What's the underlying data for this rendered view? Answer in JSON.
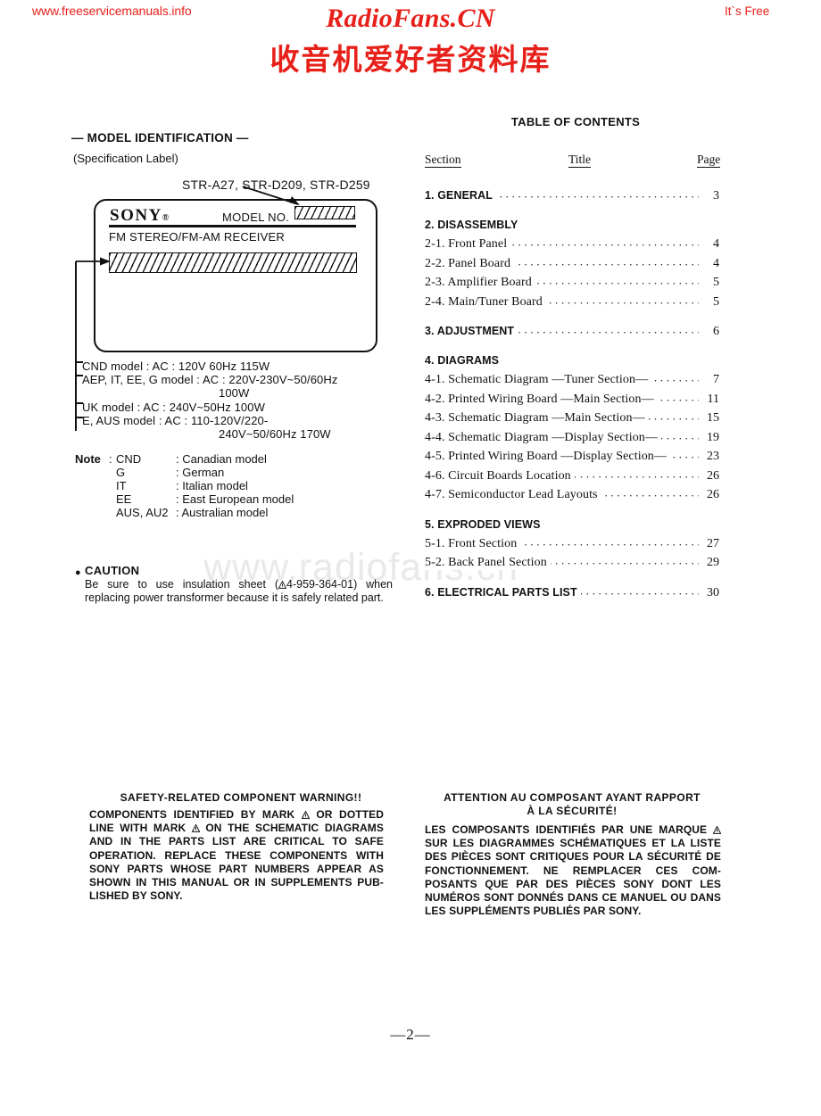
{
  "banner": {
    "left_url": "www.freeservicemanuals.info",
    "site_title": "RadioFans.CN",
    "site_subtitle": "收音机爱好者资料库",
    "right_note": "It`s Free",
    "brand_color": "#e8201a"
  },
  "watermark": "www.radiofans.cn",
  "model_identification": {
    "heading": "— MODEL IDENTIFICATION —",
    "subheading": "(Specification Label)",
    "model_numbers": "STR-A27, STR-D209, STR-D259",
    "label": {
      "brand": "SONY",
      "brand_mark": "®",
      "model_no_label": "MODEL NO.",
      "receiver_line": "FM  STEREO/FM-AM  RECEIVER"
    },
    "voltages": [
      "CND  model : AC : 120V  60Hz  115W",
      "AEP, IT, EE, G  model : AC : 220V-230V~50/60Hz",
      "100W",
      "UK  model : AC : 240V~50Hz  100W",
      "E, AUS  model : AC : 110-120V/220-",
      "240V~50/60Hz  170W"
    ],
    "note_label": "Note",
    "note_colon": ":",
    "notes": [
      {
        "key": "CND",
        "value": ": Canadian  model"
      },
      {
        "key": "G",
        "value": ": German"
      },
      {
        "key": "IT",
        "value": ": Italian  model"
      },
      {
        "key": "EE",
        "value": ": East  European  model"
      },
      {
        "key": "AUS, AU2",
        "value": ": Australian  model"
      }
    ]
  },
  "caution": {
    "bullet": "●",
    "title": "CAUTION",
    "body_part1": "Be sure to use insulation sheet (",
    "body_part2": "4-959-364-01) when replacing power transformer because it is safely related part."
  },
  "toc": {
    "title": "TABLE OF CONTENTS",
    "headers": {
      "section": "Section",
      "title": "Title",
      "page": "Page"
    },
    "entries": [
      {
        "type": "major",
        "label": "1. GENERAL",
        "page": "3",
        "dots": true
      },
      {
        "type": "major",
        "label": "2. DISASSEMBLY",
        "page": "",
        "dots": false
      },
      {
        "type": "sub",
        "label": "2-1. Front  Panel",
        "page": "4",
        "dots": true
      },
      {
        "type": "sub",
        "label": "2-2. Panel  Board",
        "page": "4",
        "dots": true
      },
      {
        "type": "sub",
        "label": "2-3. Amplifier  Board",
        "page": "5",
        "dots": true
      },
      {
        "type": "sub",
        "label": "2-4. Main/Tuner  Board",
        "page": "5",
        "dots": true
      },
      {
        "type": "major",
        "label": "3. ADJUSTMENT",
        "page": "6",
        "dots": true
      },
      {
        "type": "major",
        "label": "4. DIAGRAMS",
        "page": "",
        "dots": false
      },
      {
        "type": "sub",
        "label": "4-1. Schematic  Diagram —Tuner  Section—",
        "page": "7",
        "dots": true
      },
      {
        "type": "sub",
        "label": "4-2. Printed  Wiring  Board —Main  Section—",
        "page": "11",
        "dots": true
      },
      {
        "type": "sub",
        "label": "4-3. Schematic  Diagram —Main  Section—",
        "page": "15",
        "dots": true
      },
      {
        "type": "sub",
        "label": "4-4. Schematic  Diagram —Display  Section—",
        "page": "19",
        "dots": true
      },
      {
        "type": "sub",
        "label": "4-5. Printed  Wiring  Board —Display  Section—",
        "page": "23",
        "dots": true
      },
      {
        "type": "sub",
        "label": "4-6. Circuit  Boards  Location",
        "page": "26",
        "dots": true
      },
      {
        "type": "sub",
        "label": "4-7. Semiconductor  Lead  Layouts",
        "page": "26",
        "dots": true
      },
      {
        "type": "major",
        "label": "5. EXPRODED VIEWS",
        "page": "",
        "dots": false
      },
      {
        "type": "sub",
        "label": "5-1. Front  Section",
        "page": "27",
        "dots": true
      },
      {
        "type": "sub",
        "label": "5-2. Back  Panel  Section",
        "page": "29",
        "dots": true
      },
      {
        "type": "major",
        "label": "6. ELECTRICAL PARTS LIST",
        "page": "30",
        "dots": true
      }
    ]
  },
  "warning_english": {
    "title": "SAFETY-RELATED  COMPONENT  WARNING!!",
    "seg1": "COMPONENTS IDENTIFIED BY MARK ",
    "seg2": " OR DOTTED LINE WITH MARK ",
    "seg3": " ON THE SCHEMATIC DIAGRAMS AND IN THE PARTS LIST ARE CRITICAL TO SAFE OPERATION.  REPLACE THESE COMPONENTS WITH SONY PARTS WHOSE PART NUMBERS APPEAR AS SHOWN IN THIS MANUAL OR IN SUPPLEMENTS PUB-LISHED BY SONY."
  },
  "warning_french": {
    "title_line1": "ATTENTION  AU  COMPOSANT  AYANT  RAPPORT",
    "title_line2": "À  LA  SÉCURITÉ!",
    "seg1": "LES COMPOSANTS IDENTIFIÉS PAR UNE MARQUE ",
    "seg2": " SUR LES DIAGRAMMES SCHÉMATIQUES ET LA LISTE DES PIÈCES SONT CRITIQUES POUR LA SÉCURITÉ DE FONCTIONNEMENT.  NE REMPLACER CES COM-POSANTS QUE PAR DES PIÈCES SONY DONT LES NUMÉROS SONT DONNÉS DANS CE MANUEL OU DANS LES SUPPLÉMENTS PUBLIÉS PAR SONY."
  },
  "page_number": "—2—"
}
